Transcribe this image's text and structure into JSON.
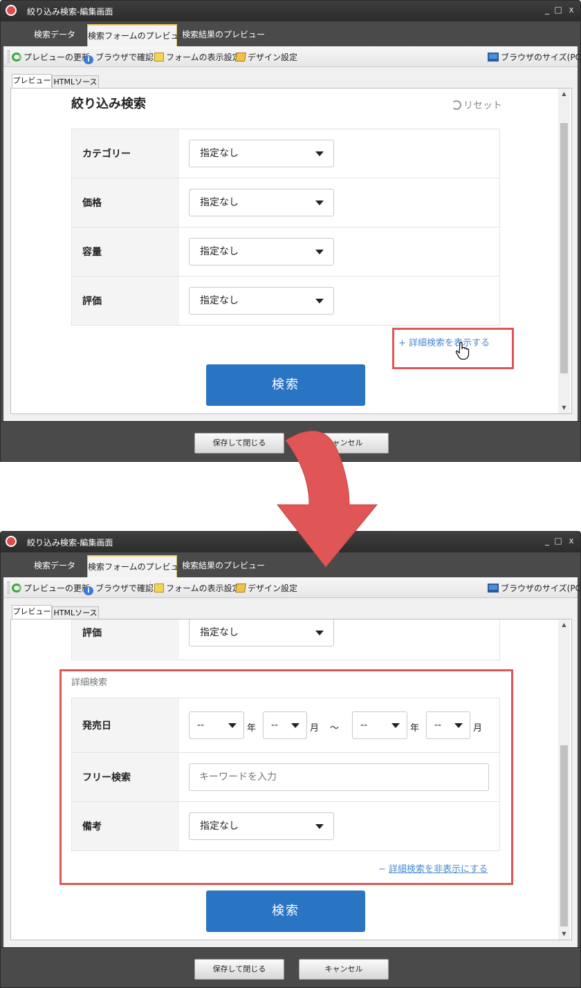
{
  "window": {
    "title": "絞り込み検索-編集画面",
    "controls": [
      "_",
      "□",
      "x"
    ]
  },
  "tabs": [
    "検索データ",
    "検索フォームのプレビュー",
    "検索結果のプレビュー"
  ],
  "toolbar": {
    "refresh": "プレビューの更新",
    "browser_check": "ブラウザで確認",
    "form_settings": "フォームの表示設定",
    "design_settings": "デザイン設定",
    "browser_size": "ブラウザのサイズ(PC)",
    "dropdown_arrow": "▾"
  },
  "subtabs": [
    "プレビュー",
    "HTMLソース"
  ],
  "form": {
    "title": "絞り込み検索",
    "reset": "リセット",
    "select_default": "指定なし",
    "rows": [
      "カテゴリー",
      "価格",
      "容量",
      "評価"
    ],
    "show_detail": "詳細検索を表示する",
    "show_prefix": "+",
    "hide_detail": "詳細検索を非表示にする",
    "hide_prefix": "−",
    "search_button": "検索"
  },
  "detail": {
    "heading": "詳細検索",
    "release_label": "発売日",
    "date_placeholder": "--",
    "year": "年",
    "month": "月",
    "range": "〜",
    "free_label": "フリー検索",
    "free_placeholder": "キーワードを入力",
    "notes_label": "備考"
  },
  "footer": {
    "save": "保存して閉じる",
    "cancel": "キャンセル"
  },
  "colors": {
    "accent": "#2a74c4",
    "highlight": "#e05555",
    "link": "#4a8ad0",
    "chrome": "#4a4a4a"
  },
  "icons": [
    "app-icon",
    "refresh-icon",
    "info-icon",
    "form-icon",
    "design-icon",
    "monitor-icon",
    "reset-icon",
    "caret-down-icon",
    "hand-cursor-icon",
    "down-arrow-icon"
  ]
}
